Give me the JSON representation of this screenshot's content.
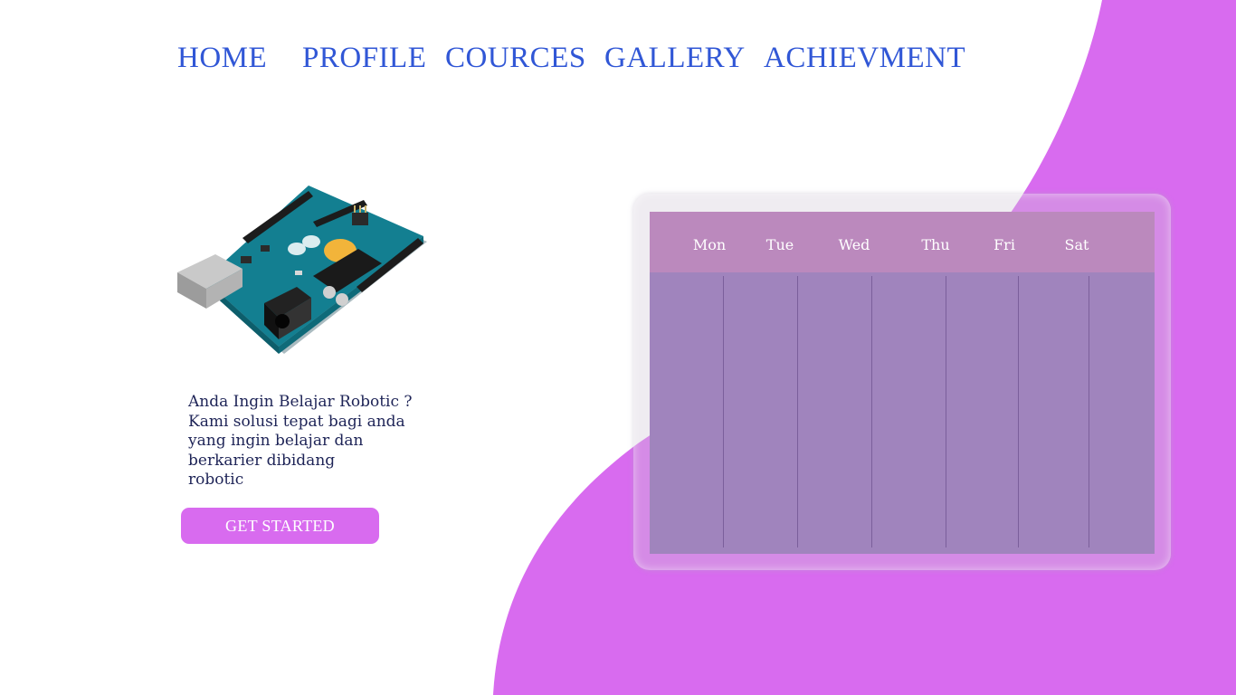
{
  "nav": {
    "items": [
      {
        "label": "HOME"
      },
      {
        "label": "PROFILE"
      },
      {
        "label": "COURCES"
      },
      {
        "label": "GALLERY"
      },
      {
        "label": "ACHIEVMENT"
      }
    ]
  },
  "hero": {
    "image": "arduino-uno-board",
    "text_lines": [
      "Anda Ingin Belajar Robotic ?",
      "Kami solusi tepat bagi anda",
      "yang ingin belajar dan",
      "berkarier dibidang",
      "robotic"
    ],
    "cta_label": "GET STARTED"
  },
  "calendar": {
    "days": [
      "Mon",
      "Tue",
      "Wed",
      "Thu",
      "Fri",
      "Sat"
    ]
  },
  "colors": {
    "nav_text": "#3157d6",
    "accent": "#d86bef",
    "calendar_body": "#a084bd",
    "calendar_header": "#bb89bd",
    "text_dark": "#1e2457"
  }
}
